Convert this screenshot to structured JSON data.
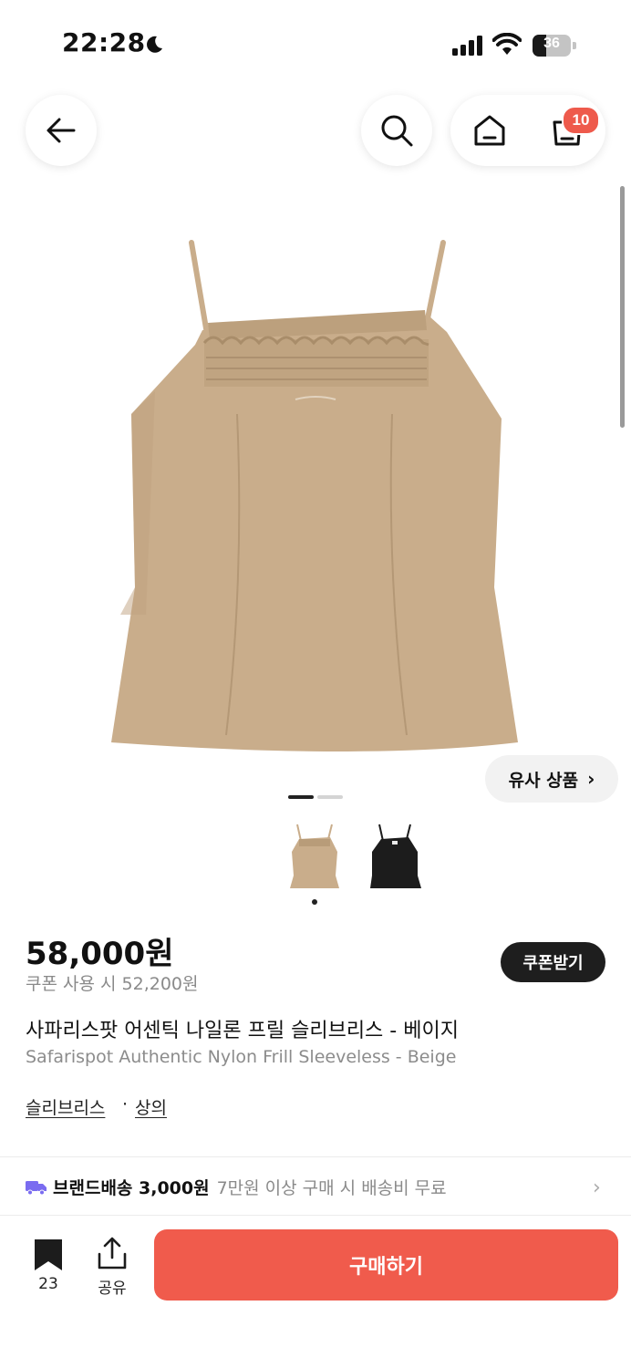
{
  "status_bar": {
    "time": "22:28",
    "battery": "36"
  },
  "header": {
    "cart_count": "10"
  },
  "gallery": {
    "similar_label": "유사 상품",
    "image_count": 2,
    "active_index": 0
  },
  "product": {
    "price": "58,000원",
    "coupon_price": "쿠폰 사용 시 52,200원",
    "coupon_button": "쿠폰받기",
    "title_ko": "사파리스팟 어센틱 나일론 프릴 슬리브리스 - 베이지",
    "title_en": "Safarispot Authentic Nylon Frill Sleeveless - Beige",
    "categories": [
      "슬리브리스",
      "상의"
    ],
    "category_separator": "·"
  },
  "shipping": {
    "label": "브랜드배송 3,000원",
    "condition": "7만원 이상 구매 시 배송비 무료"
  },
  "bottom_bar": {
    "bookmark_count": "23",
    "share_label": "공유",
    "buy_label": "구매하기"
  },
  "colors": {
    "accent": "#f05b4c",
    "product_beige": "#c9ad8b",
    "product_black": "#1c1c1c",
    "shipping_icon": "#7a6cf0"
  },
  "icons": [
    "moon-icon",
    "signal-icon",
    "wifi-icon",
    "battery-icon",
    "back-arrow-icon",
    "search-icon",
    "home-icon",
    "cart-icon",
    "chevron-right-icon",
    "truck-icon",
    "bookmark-icon",
    "share-icon"
  ]
}
